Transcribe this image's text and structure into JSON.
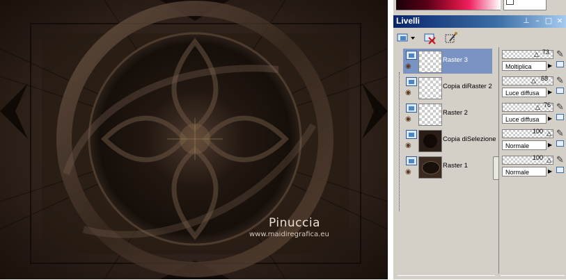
{
  "canvas": {
    "watermark_title": "Pinuccia",
    "watermark_url": "www.maidiregrafica.eu"
  },
  "palette": {
    "checkbox_label": ""
  },
  "panel": {
    "title": "Livelli",
    "buttons": [
      "pin-icon",
      "minimize-icon",
      "maximize-icon",
      "close-icon"
    ],
    "toolbar": [
      "new-layer-icon",
      "delete-layer-icon",
      "layer-properties-icon"
    ]
  },
  "layers": [
    {
      "name": "Raster 3",
      "selected": true,
      "thumb": "transparent",
      "opacity": "73",
      "blend": "Moltiplica"
    },
    {
      "name": "Copia diRaster 2",
      "selected": false,
      "thumb": "transparent",
      "opacity": "68",
      "blend": "Luce diffusa"
    },
    {
      "name": "Raster 2",
      "selected": false,
      "thumb": "transparent",
      "opacity": "76",
      "blend": "Luce diffusa"
    },
    {
      "name": "Copia diSelezione",
      "selected": false,
      "thumb": "dark",
      "opacity": "100",
      "blend": "Normale"
    },
    {
      "name": "Raster 1",
      "selected": false,
      "thumb": "ornament",
      "opacity": "100",
      "blend": "Normale"
    }
  ],
  "colors": {
    "title_bar": "#0a246a",
    "selected_row": "#7b93c2",
    "canvas_bg": "#2a1e16"
  }
}
